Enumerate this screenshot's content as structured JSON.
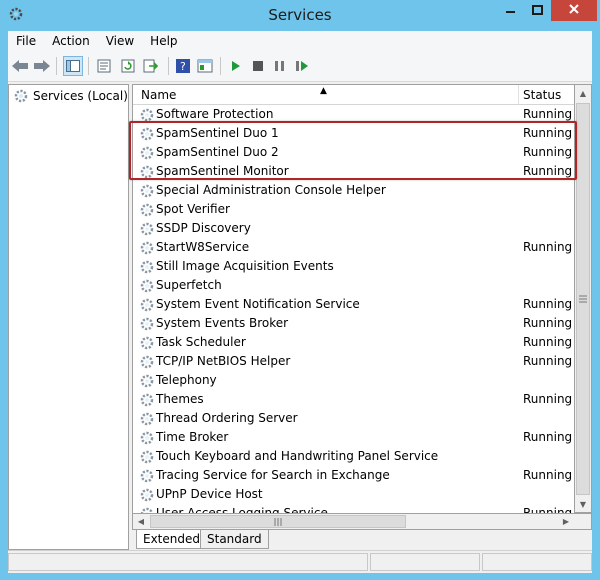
{
  "window": {
    "title": "Services",
    "buttons": {
      "minimize": "minimize-icon",
      "maximize": "maximize-icon",
      "close": "close-icon"
    }
  },
  "menu": [
    "File",
    "Action",
    "View",
    "Help"
  ],
  "tree": {
    "root": "Services (Local)"
  },
  "columns": {
    "name": "Name",
    "status": "Status"
  },
  "services": [
    {
      "name": "Software Protection",
      "status": "Running"
    },
    {
      "name": "SpamSentinel Duo 1",
      "status": "Running"
    },
    {
      "name": "SpamSentinel Duo 2",
      "status": "Running"
    },
    {
      "name": "SpamSentinel Monitor",
      "status": "Running"
    },
    {
      "name": "Special Administration Console Helper",
      "status": ""
    },
    {
      "name": "Spot Verifier",
      "status": ""
    },
    {
      "name": "SSDP Discovery",
      "status": ""
    },
    {
      "name": "StartW8Service",
      "status": "Running"
    },
    {
      "name": "Still Image Acquisition Events",
      "status": ""
    },
    {
      "name": "Superfetch",
      "status": ""
    },
    {
      "name": "System Event Notification Service",
      "status": "Running"
    },
    {
      "name": "System Events Broker",
      "status": "Running"
    },
    {
      "name": "Task Scheduler",
      "status": "Running"
    },
    {
      "name": "TCP/IP NetBIOS Helper",
      "status": "Running"
    },
    {
      "name": "Telephony",
      "status": ""
    },
    {
      "name": "Themes",
      "status": "Running"
    },
    {
      "name": "Thread Ordering Server",
      "status": ""
    },
    {
      "name": "Time Broker",
      "status": "Running"
    },
    {
      "name": "Touch Keyboard and Handwriting Panel Service",
      "status": ""
    },
    {
      "name": "Tracing Service for Search in Exchange",
      "status": "Running"
    },
    {
      "name": "UPnP Device Host",
      "status": ""
    },
    {
      "name": "User Access Logging Service",
      "status": "Running"
    }
  ],
  "tabs": [
    "Extended",
    "Standard"
  ],
  "colors": {
    "titlebar": "#6ec4ea",
    "close": "#c7463c",
    "highlight": "#b02525"
  },
  "toolbar_icons": [
    "back-icon",
    "forward-icon",
    "show-tree-icon",
    "properties-icon",
    "refresh-icon",
    "export-icon",
    "help-icon",
    "console-icon",
    "start-icon",
    "stop-icon",
    "pause-icon",
    "restart-icon"
  ]
}
